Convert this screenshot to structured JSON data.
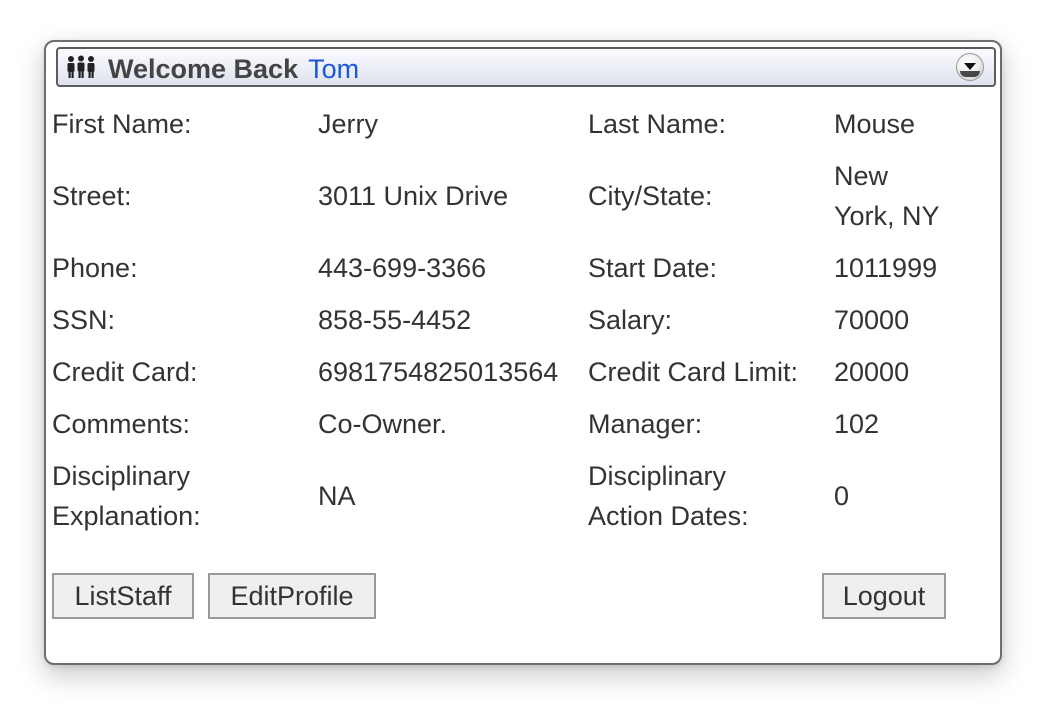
{
  "header": {
    "greeting": "Welcome Back",
    "user_name": "Tom",
    "icon": "staff-group-icon",
    "collapse_icon": "collapse-down-icon"
  },
  "profile": {
    "first_name": {
      "label": "First Name:",
      "value": "Jerry"
    },
    "last_name": {
      "label": "Last Name:",
      "value": "Mouse"
    },
    "street": {
      "label": "Street:",
      "value": "3011 Unix Drive"
    },
    "city_state": {
      "label": "City/State:",
      "value_line1": "New",
      "value_line2": "York, NY"
    },
    "phone": {
      "label": "Phone:",
      "value": "443-699-3366"
    },
    "start_date": {
      "label": "Start Date:",
      "value": "1011999"
    },
    "ssn": {
      "label": "SSN:",
      "value": "858-55-4452"
    },
    "salary": {
      "label": "Salary:",
      "value": "70000"
    },
    "credit_card": {
      "label": "Credit Card:",
      "value": "6981754825013564"
    },
    "credit_limit": {
      "label": "Credit Card Limit:",
      "value": "20000"
    },
    "comments": {
      "label": "Comments:",
      "value": "Co-Owner."
    },
    "manager": {
      "label": "Manager:",
      "value": "102"
    },
    "disciplinary_explanation": {
      "label_line1": "Disciplinary",
      "label_line2": "Explanation:",
      "value": "NA"
    },
    "disciplinary_dates": {
      "label_line1": "Disciplinary",
      "label_line2": "Action Dates:",
      "value": "0"
    }
  },
  "actions": {
    "list_staff": "ListStaff",
    "edit_profile": "EditProfile",
    "logout": "Logout"
  },
  "colors": {
    "user_name": "#1a56db",
    "text": "#333333",
    "border": "#6e6e6e",
    "button_bg": "#efefef"
  }
}
